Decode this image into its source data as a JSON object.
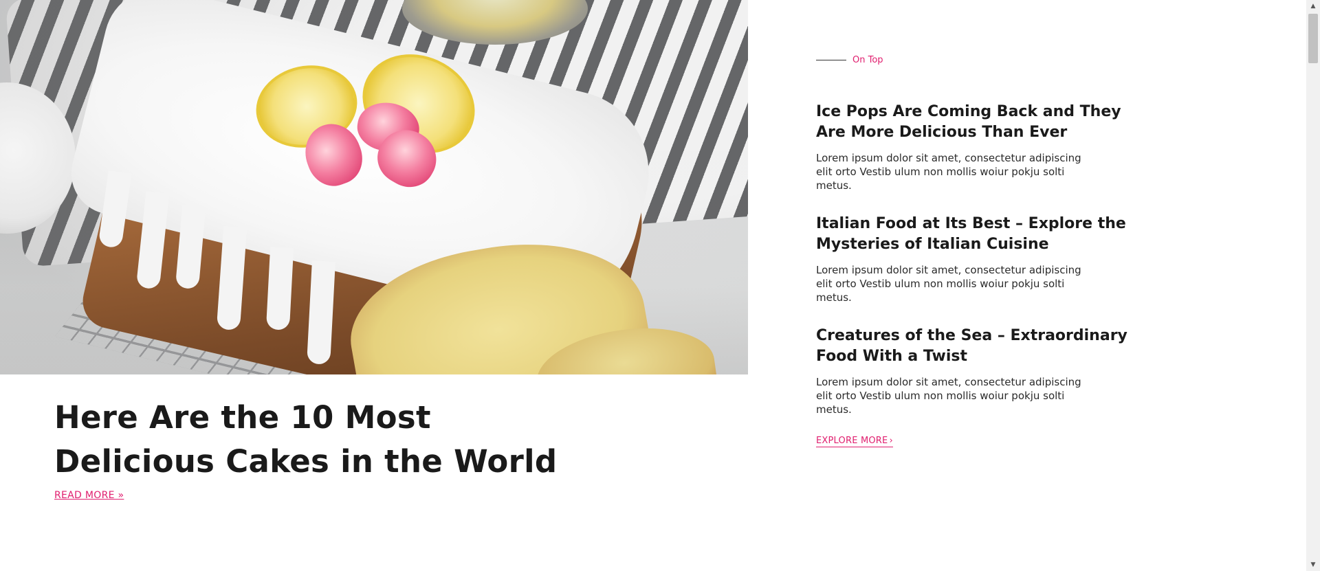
{
  "hero": {
    "image_alt": "Lemon drizzle cake with icing, lemon slices and pink flowers"
  },
  "featured": {
    "title": "Here Are the 10 Most Delicious Cakes in the World",
    "read_more": "READ MORE »"
  },
  "sidebar": {
    "kicker": "On Top",
    "articles": [
      {
        "title": "Ice Pops Are Coming Back and They Are More Delicious Than Ever",
        "excerpt": "Lorem ipsum dolor sit amet, consectetur adipiscing elit orto Vestib ulum non mollis woiur pokju solti metus."
      },
      {
        "title": "Italian Food at Its Best – Explore the Mysteries of Italian Cuisine",
        "excerpt": "Lorem ipsum dolor sit amet, consectetur adipiscing elit orto Vestib ulum non mollis woiur pokju solti metus."
      },
      {
        "title": "Creatures of the Sea – Extraordinary Food With a Twist",
        "excerpt": "Lorem ipsum dolor sit amet, consectetur adipiscing elit orto Vestib ulum non mollis woiur pokju solti metus."
      }
    ],
    "explore_more": "EXPLORE MORE",
    "explore_icon": "chevron-right-icon"
  },
  "scrollbar": {
    "up_icon": "arrow-up-icon",
    "down_icon": "arrow-down-icon"
  },
  "colors": {
    "accent": "#e01e6e",
    "text": "#1a1a1a"
  }
}
